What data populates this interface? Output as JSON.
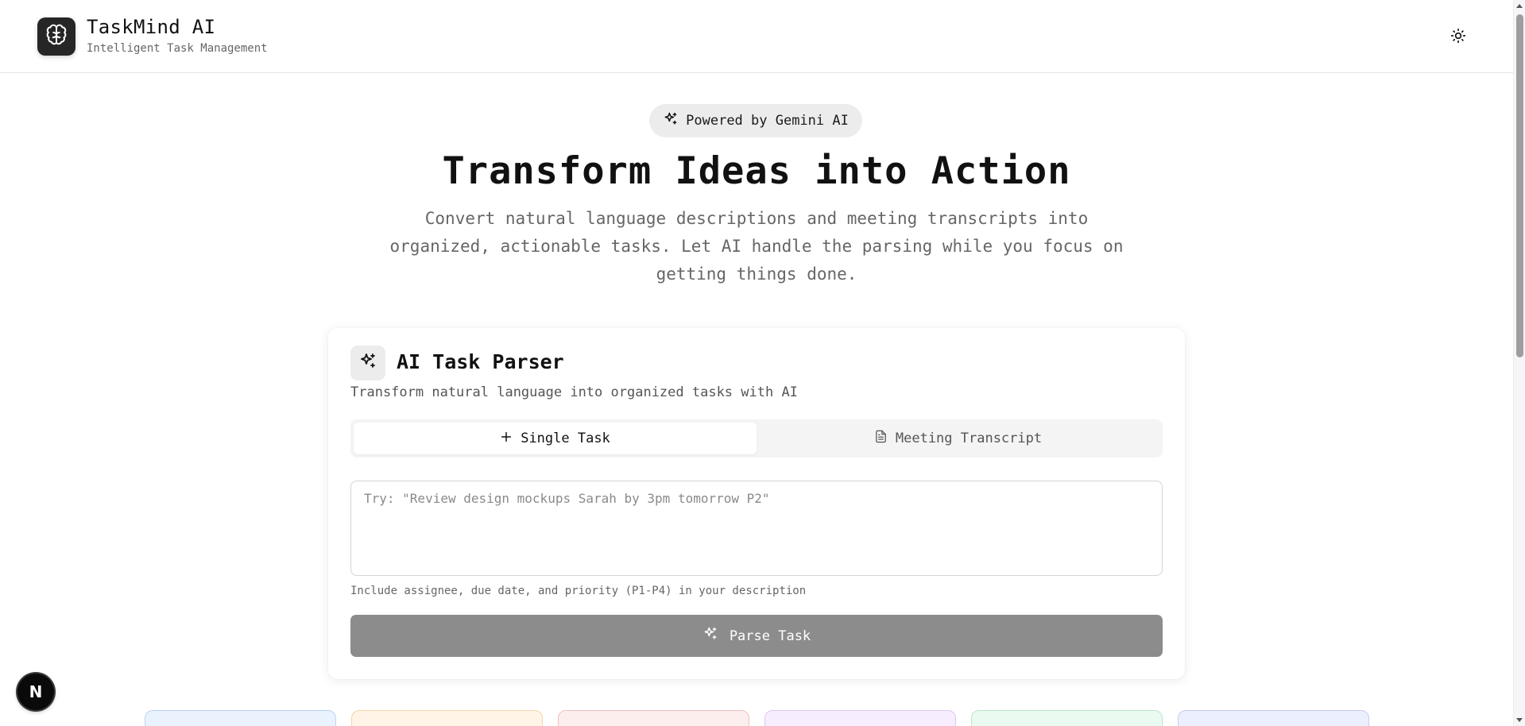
{
  "header": {
    "app_title": "TaskMind AI",
    "app_subtitle": "Intelligent Task Management",
    "logo_icon": "brain-icon",
    "theme_icon": "sun-icon"
  },
  "hero": {
    "badge_label": "Powered by Gemini AI",
    "title": "Transform Ideas into Action",
    "description": "Convert natural language descriptions and meeting transcripts into organized, actionable tasks. Let AI handle the parsing while you focus on getting things done."
  },
  "parser": {
    "title": "AI Task Parser",
    "subtitle": "Transform natural language into organized tasks with AI",
    "tabs": [
      {
        "label": "Single Task",
        "icon": "plus-icon",
        "active": true
      },
      {
        "label": "Meeting Transcript",
        "icon": "file-text-icon",
        "active": false
      }
    ],
    "input_value": "",
    "input_placeholder": "Try: \"Review design mockups Sarah by 3pm tomorrow P2\"",
    "hint": "Include assignee, due date, and priority (P1-P4) in your description",
    "parse_button_label": "Parse Task"
  },
  "floating_button": {
    "label": "N"
  },
  "colors": {
    "accent": "#262626",
    "button_disabled": "#8c8c8c",
    "mini_cards": [
      {
        "bg": "#eaf2fe",
        "border": "#bcd4f6"
      },
      {
        "bg": "#fff4e6",
        "border": "#f7d3a8"
      },
      {
        "bg": "#fdeeee",
        "border": "#f1c0c0"
      },
      {
        "bg": "#f6eefe",
        "border": "#dcc6f3"
      },
      {
        "bg": "#ebfaf0",
        "border": "#b9e6c8"
      },
      {
        "bg": "#eceffd",
        "border": "#c4ccf2"
      }
    ]
  }
}
